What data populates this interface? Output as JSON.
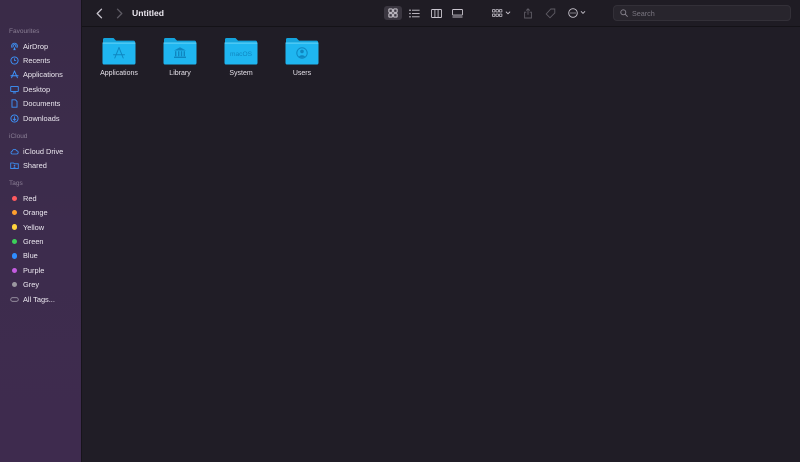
{
  "window": {
    "title": "Untitled"
  },
  "sidebar": {
    "favourites_header": "Favourites",
    "favourites": [
      {
        "label": "AirDrop",
        "icon": "airdrop-icon"
      },
      {
        "label": "Recents",
        "icon": "clock-icon"
      },
      {
        "label": "Applications",
        "icon": "applications-icon"
      },
      {
        "label": "Desktop",
        "icon": "desktop-icon"
      },
      {
        "label": "Documents",
        "icon": "document-icon"
      },
      {
        "label": "Downloads",
        "icon": "download-icon"
      }
    ],
    "icloud_header": "iCloud",
    "icloud": [
      {
        "label": "iCloud Drive",
        "icon": "cloud-icon"
      },
      {
        "label": "Shared",
        "icon": "shared-folder-icon"
      }
    ],
    "tags_header": "Tags",
    "tags": [
      {
        "label": "Red",
        "color": "#ff5a5f"
      },
      {
        "label": "Orange",
        "color": "#ff9f2e"
      },
      {
        "label": "Yellow",
        "color": "#ffd33d"
      },
      {
        "label": "Green",
        "color": "#3ccf5a"
      },
      {
        "label": "Blue",
        "color": "#2f8cff"
      },
      {
        "label": "Purple",
        "color": "#c45ce0"
      },
      {
        "label": "Grey",
        "color": "#9b98a0"
      }
    ],
    "all_tags": "All Tags..."
  },
  "toolbar": {
    "search_placeholder": "Search"
  },
  "items": [
    {
      "label": "Applications",
      "icon": "applications-folder-icon"
    },
    {
      "label": "Library",
      "icon": "library-folder-icon"
    },
    {
      "label": "System",
      "icon": "system-folder-icon",
      "badge": "macOS"
    },
    {
      "label": "Users",
      "icon": "users-folder-icon"
    }
  ],
  "colors": {
    "accent": "#2f8cff",
    "folder": "#1fb6f0",
    "background": "#201d26"
  }
}
